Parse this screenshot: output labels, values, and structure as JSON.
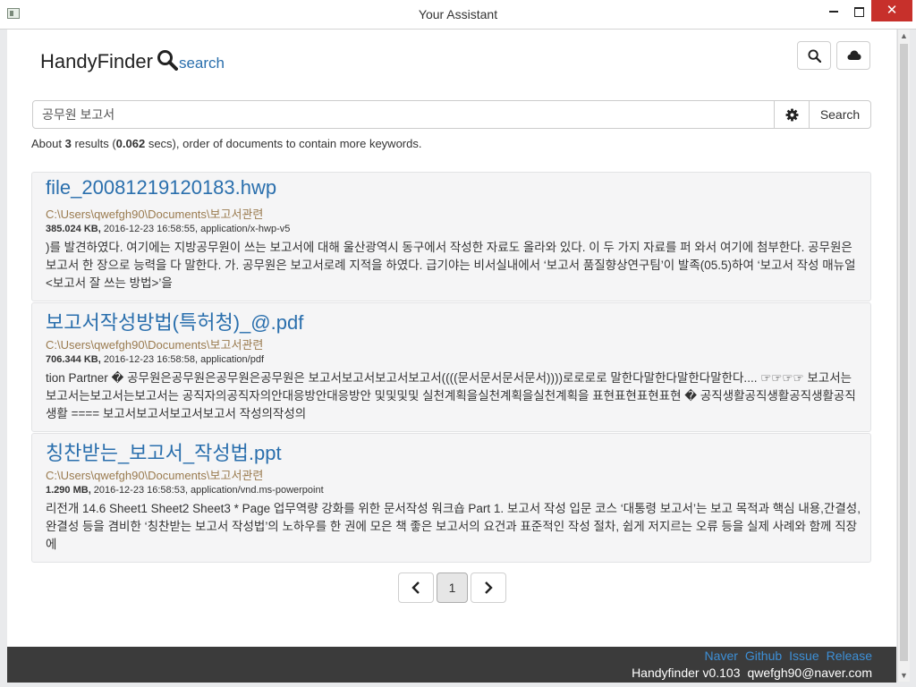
{
  "window": {
    "title": "Your Assistant",
    "close_glyph": "✕"
  },
  "header": {
    "brand": "HandyFinder",
    "brand_search": "search"
  },
  "search": {
    "query": "공무원 보고서",
    "button_label": "Search"
  },
  "summary": {
    "prefix": "About ",
    "count": "3",
    "mid": " results (",
    "time": "0.062",
    "suffix": " secs), order of documents to contain more keywords."
  },
  "results": [
    {
      "title": "file_20081219120183.hwp",
      "path": "C:\\Users\\qwefgh90\\Documents\\보고서관련",
      "size": "385.024 KB,",
      "meta": " 2016-12-23 16:58:55, application/x-hwp-v5",
      "snippet": ")를 발견하였다. 여기에는 지방공무원이 쓰는 보고서에 대해 울산광역시 동구에서 작성한 자료도 올라와 있다. 이 두 가지 자료를 퍼 와서 여기에 첨부한다. 공무원은 보고서 한 장으로 능력을 다 말한다. 가. 공무원은 보고서로례 지적을 하였다. 급기야는 비서실내에서 ‘보고서 품질향상연구팀’이 발족(05.5)하여 ‘보고서 작성 매뉴얼<보고서 잘 쓰는 방법>’을"
    },
    {
      "title": "보고서작성방법(특허청)_@.pdf",
      "path": "C:\\Users\\qwefgh90\\Documents\\보고서관련",
      "size": "706.344 KB,",
      "meta": " 2016-12-23 16:58:58, application/pdf",
      "snippet": "tion Partner � 공무원은공무원은공무원은공무원은 보고서보고서보고서보고서((((문서문서문서문서))))로로로로 말한다말한다말한다말한다.... ☞☞☞☞ 보고서는보고서는보고서는보고서는 공직자의공직자의안대응방안대응방안 및및및및 실천계획을실천계획을실천계획을 표현표현표현표현 � 공직생활공직생활공직생활공직생활 ==== 보고서보고서보고서보고서 작성의작성의"
    },
    {
      "title": "칭찬받는_보고서_작성법.ppt",
      "path": "C:\\Users\\qwefgh90\\Documents\\보고서관련",
      "size": "1.290 MB,",
      "meta": " 2016-12-23 16:58:53, application/vnd.ms-powerpoint",
      "snippet": "리전개 14.6 Sheet1 Sheet2 Sheet3 * Page 업무역량 강화를 위한 문서작성 워크숍 Part 1. 보고서 작성 입문 코스 ‘대통령 보고서’는 보고 목적과 핵심 내용,간결성,완결성 등을 겸비한 ‘칭찬받는 보고서 작성법’의 노하우를 한 권에 모은 책 좋은 보고서의 요건과 표준적인 작성 절차, 쉽게 저지르는 오류 등을 실제 사례와 함께 직장에"
    }
  ],
  "pagination": {
    "current": "1"
  },
  "footer": {
    "links": [
      "Naver",
      "Github",
      "Issue",
      "Release"
    ],
    "version": "Handyfinder v0.103",
    "email": "qwefgh90@naver.com"
  },
  "colors": {
    "link": "#2a6fad",
    "path": "#9a7b4f",
    "footer_bg": "#3b3b3b",
    "footer_link": "#3d8fd6",
    "close_button": "#c7302b"
  }
}
